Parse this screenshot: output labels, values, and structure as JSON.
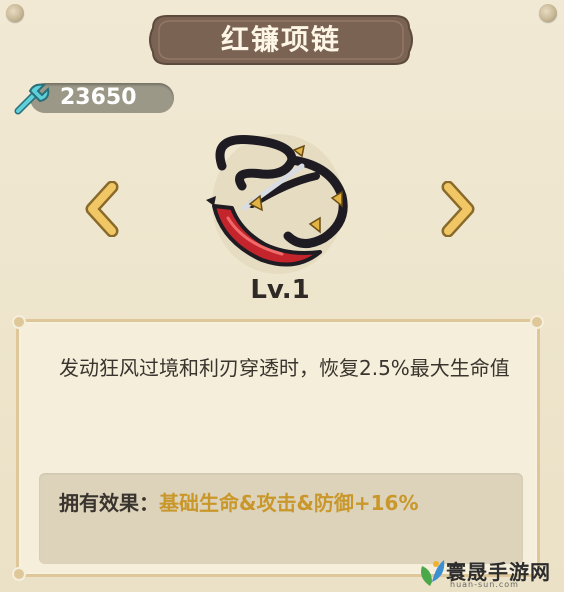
{
  "title": "红镰项链",
  "currency": {
    "icon": "wrench-icon",
    "value": "23650"
  },
  "item": {
    "icon": "red-scythe-necklace-icon",
    "level": "Lv.1"
  },
  "description": "发动狂风过境和利刃穿透时，恢复2.5%最大生命值",
  "effect": {
    "label": "拥有效果：",
    "value": "基础生命&攻击&防御+16%"
  },
  "watermark": {
    "name": "寰晟手游网",
    "url": "huan-sun.com"
  },
  "colors": {
    "accent": "#c9972a",
    "plaque": "#7a6353",
    "panel_border": "#dec89a"
  }
}
